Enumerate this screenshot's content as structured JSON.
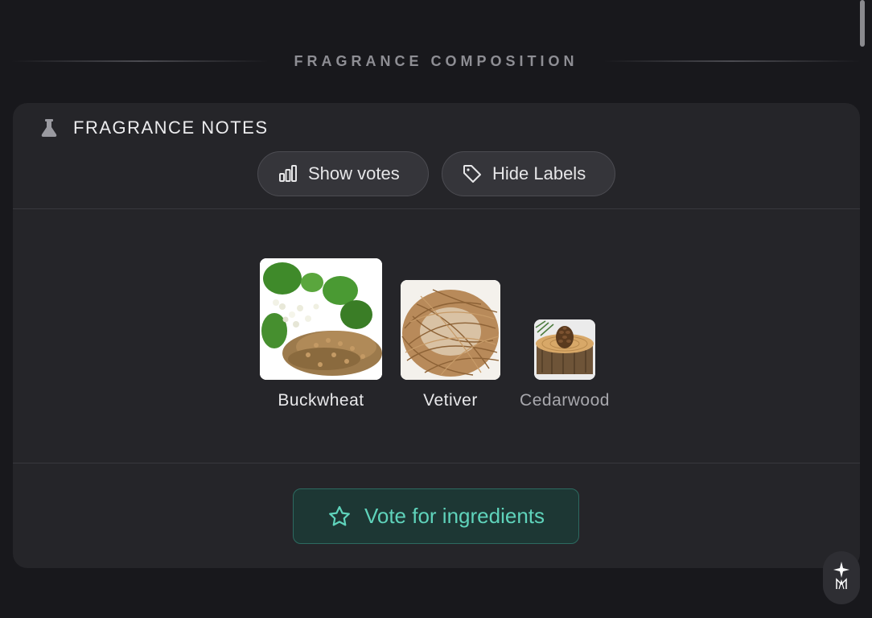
{
  "section": {
    "title": "FRAGRANCE COMPOSITION"
  },
  "card": {
    "title": "FRAGRANCE NOTES",
    "title_icon": "flask-icon",
    "buttons": {
      "votes": {
        "label": "Show votes",
        "icon": "bar-chart-icon"
      },
      "labels": {
        "label": "Hide Labels",
        "icon": "tag-icon"
      }
    },
    "notes": [
      {
        "name": "Buckwheat"
      },
      {
        "name": "Vetiver"
      },
      {
        "name": "Cedarwood"
      }
    ],
    "vote": {
      "label": "Vote for ingredients",
      "icon": "star-icon"
    }
  },
  "floating_button": {
    "icon": "assistant-icon"
  },
  "colors": {
    "background": "#18181c",
    "card": "#252529",
    "accent": "#5fd3bb",
    "accent_bg": "#1d3734"
  }
}
